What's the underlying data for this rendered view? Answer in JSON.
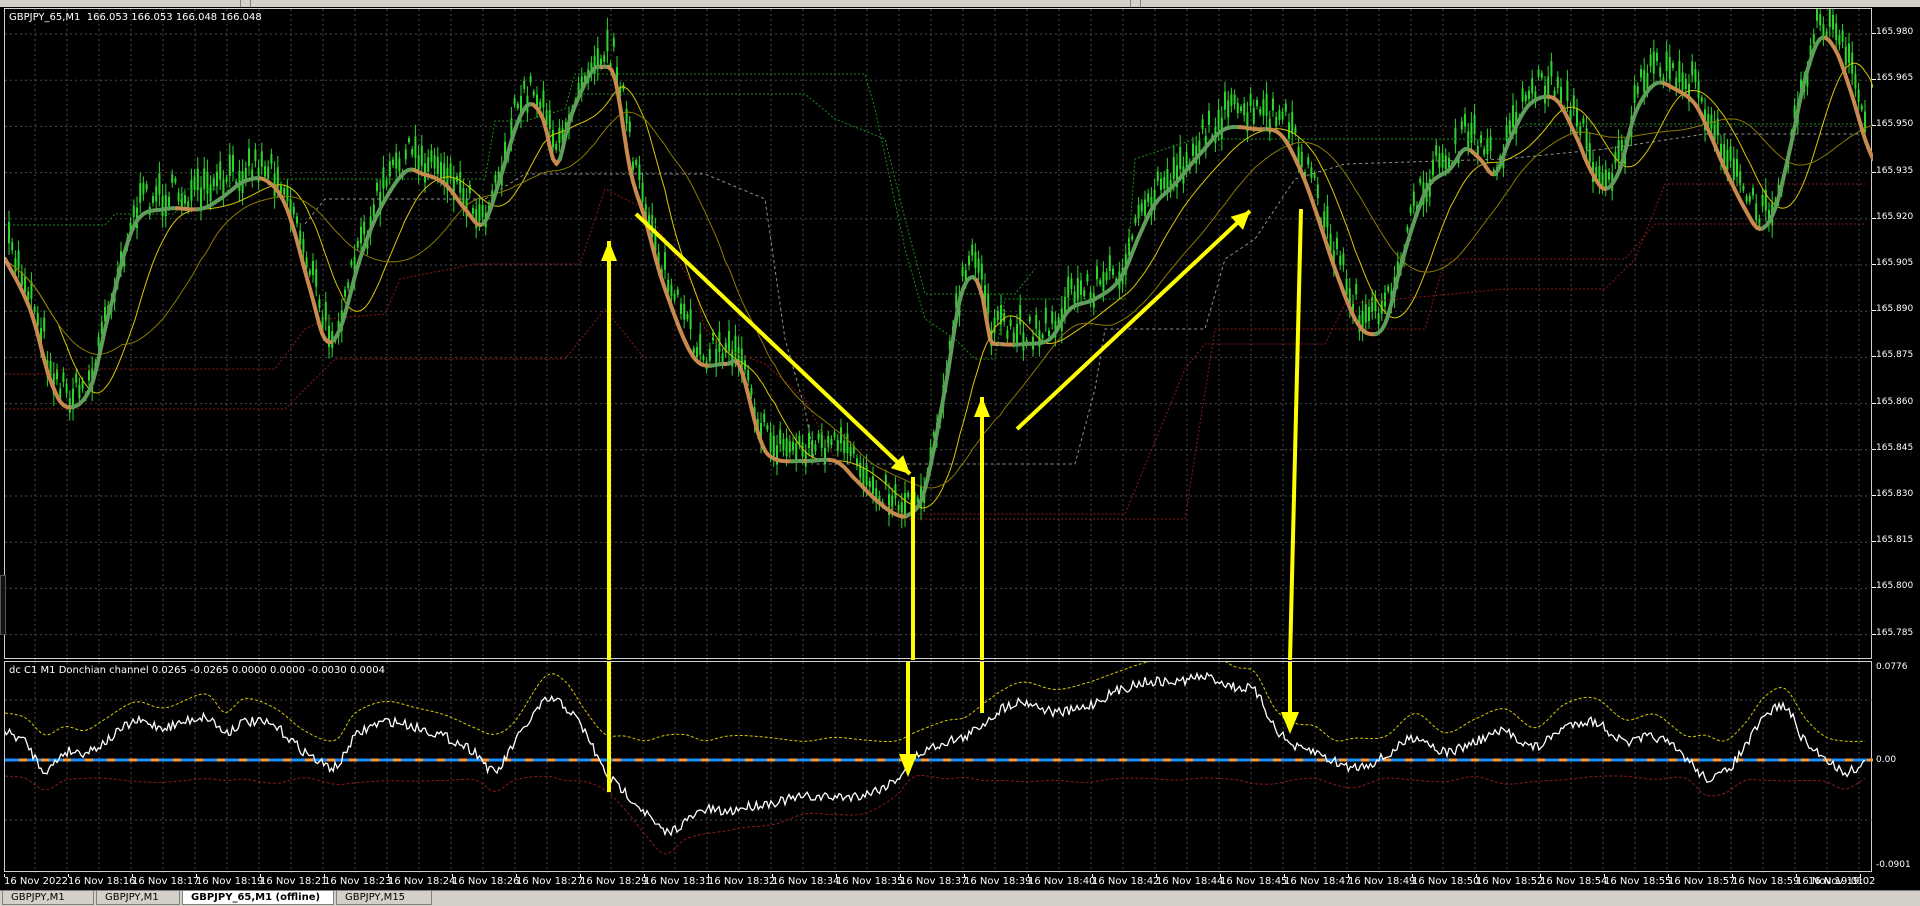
{
  "main_pane": {
    "title": "GBPJPY_65,M1  166.053 166.053 166.048 166.048",
    "price_labels": [
      "165.980",
      "165.965",
      "165.950",
      "165.935",
      "165.920",
      "165.905",
      "165.890",
      "165.875",
      "165.860",
      "165.845",
      "165.830",
      "165.815",
      "165.800",
      "165.785"
    ]
  },
  "indicator_pane": {
    "title": "dc C1 M1 Donchian channel 0.0265 -0.0265 0.0000 0.0000 -0.0030 0.0004",
    "levels": [
      "0.0776",
      "0.00",
      "-0.0901"
    ]
  },
  "time_axis": {
    "labels": [
      "16 Nov 2022",
      "16 Nov 18:16",
      "16 Nov 18:17",
      "16 Nov 18:19",
      "16 Nov 18:21",
      "16 Nov 18:23",
      "16 Nov 18:24",
      "16 Nov 18:26",
      "16 Nov 18:27",
      "16 Nov 18:29",
      "16 Nov 18:31",
      "16 Nov 18:32",
      "16 Nov 18:34",
      "16 Nov 18:35",
      "16 Nov 18:37",
      "16 Nov 18:39",
      "16 Nov 18:40",
      "16 Nov 18:42",
      "16 Nov 18:44",
      "16 Nov 18:45",
      "16 Nov 18:47",
      "16 Nov 18:49",
      "16 Nov 18:50",
      "16 Nov 18:52",
      "16 Nov 18:54",
      "16 Nov 18:55",
      "16 Nov 18:57",
      "16 Nov 18:59",
      "16 Nov 19:01",
      "16 Nov 19:02"
    ]
  },
  "tabs": [
    {
      "label": "GBPJPY,M1"
    },
    {
      "label": "GBPJPY,M1"
    },
    {
      "label": "GBPJPY_65,M1 (offline)"
    },
    {
      "label": "GBPJPY,M15"
    }
  ],
  "colors": {
    "background": "#000000",
    "grid": "#4a4a4a",
    "candles": "#2bd62b",
    "smooth_up": "#5e9e5a",
    "smooth_down": "#c8894e",
    "ma": "#d8c800",
    "donchian_upper": "#1a8f1a",
    "donchian_lower": "#8b1a1a",
    "donchian_mid": "#909090",
    "arrows": "#ffff00",
    "osc_line": "#ffffff",
    "zero_blue": "#1e90ff",
    "zero_orange": "#ff9933"
  },
  "icons": [
    "arrow-up-icon",
    "arrow-down-icon"
  ]
}
